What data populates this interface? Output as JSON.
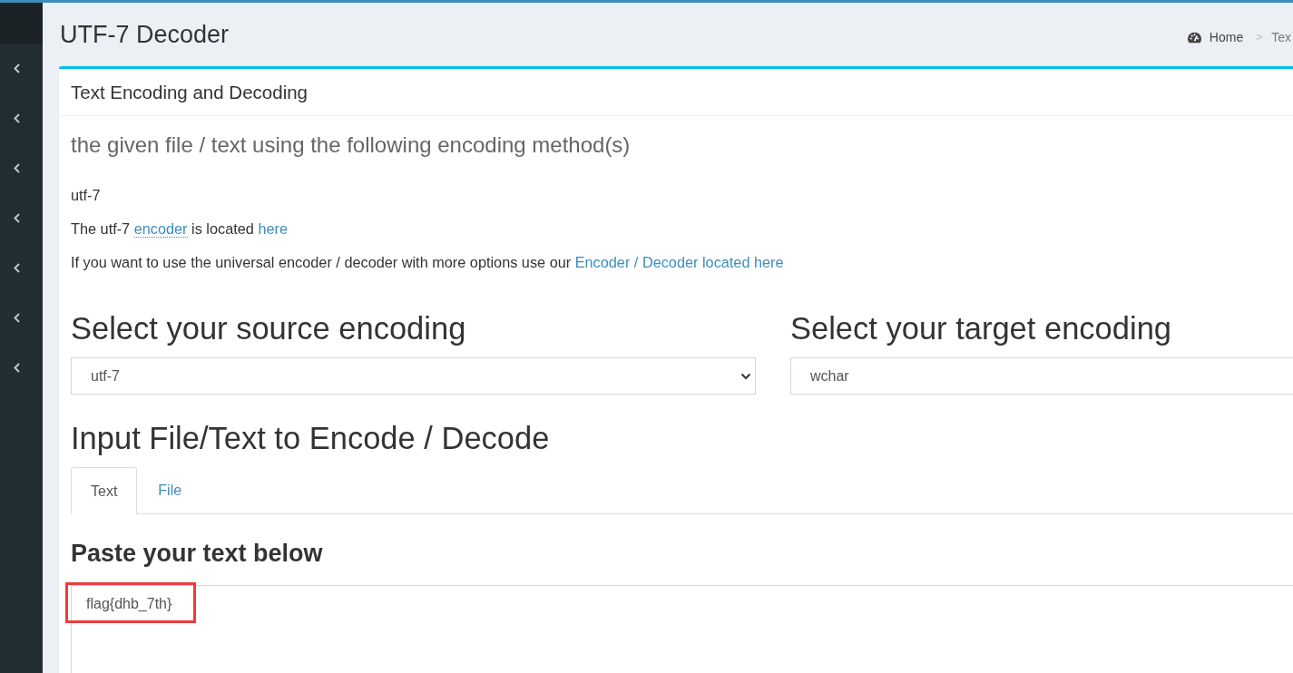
{
  "sidebar": {
    "items": [
      {
        "expanded": false
      },
      {
        "expanded": false
      },
      {
        "expanded": false
      },
      {
        "expanded": false
      },
      {
        "expanded": false
      },
      {
        "expanded": false
      },
      {
        "expanded": false
      }
    ]
  },
  "page_header": {
    "title": "UTF-7 Decoder",
    "breadcrumb": {
      "separator": ">",
      "items": [
        {
          "label": "Home",
          "active": false
        },
        {
          "label": "Tex",
          "active": true
        }
      ]
    }
  },
  "box": {
    "title": "Text Encoding and Decoding",
    "subtitle": "the given file / text using the following encoding method(s)",
    "paragraphs": [
      [
        {
          "kind": "text",
          "text": "utf-7"
        }
      ],
      [
        {
          "kind": "text",
          "text": "The utf-7 "
        },
        {
          "kind": "abbr",
          "text": "encoder"
        },
        {
          "kind": "text",
          "text": " is located "
        },
        {
          "kind": "link",
          "text": "here"
        }
      ],
      [
        {
          "kind": "text",
          "text": "If you want to use the universal encoder / decoder with more options use our "
        },
        {
          "kind": "link",
          "text": "Encoder / Decoder located here"
        }
      ]
    ],
    "source_encoding": {
      "heading": "Select your source encoding",
      "value": "utf-7"
    },
    "target_encoding": {
      "heading": "Select your target encoding",
      "value": "wchar"
    },
    "input_heading": "Input File/Text to Encode / Decode",
    "tabs": [
      {
        "label": "Text",
        "selected": true
      },
      {
        "label": "File",
        "selected": false
      }
    ],
    "text_panel": {
      "heading": "Paste your text below",
      "value": "flag{dhb_7th}",
      "highlighted": true
    }
  }
}
